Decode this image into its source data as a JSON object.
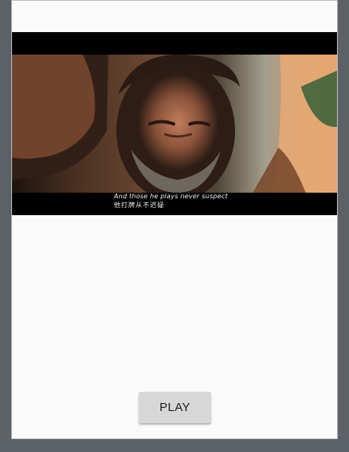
{
  "video": {
    "subtitle_line1": "And those he plays never suspect",
    "subtitle_line2": "他打牌从不迟疑"
  },
  "controls": {
    "play_label": "PLAY"
  },
  "colors": {
    "frame": "#5b6166",
    "screen_background": "#fafafa",
    "button_background": "#d7d7d7"
  }
}
